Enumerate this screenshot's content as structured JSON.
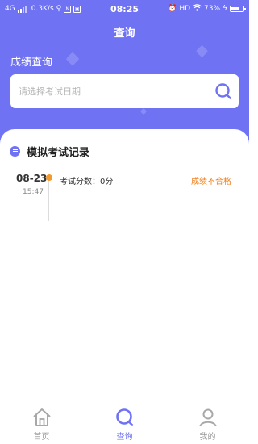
{
  "status_bar": {
    "network": "4G",
    "speed": "0.3K/s",
    "time": "08:25",
    "hd": "HD",
    "battery": "73%",
    "battery_level": 0.73
  },
  "header": {
    "title": "查询"
  },
  "search": {
    "label": "成绩查询",
    "placeholder": "请选择考试日期"
  },
  "records": {
    "title": "模拟考试记录",
    "items": [
      {
        "date": "08-23",
        "time": "15:47",
        "score": "考试分数：0分",
        "status": "成绩不合格"
      }
    ]
  },
  "tabbar": {
    "items": [
      {
        "label": "首页",
        "icon": "home-icon",
        "active": false
      },
      {
        "label": "查询",
        "icon": "search-icon",
        "active": true
      },
      {
        "label": "我的",
        "icon": "user-icon",
        "active": false
      }
    ]
  },
  "colors": {
    "primary": "#6e72f3",
    "warning": "#f07f1a",
    "dot": "#f39a2e"
  }
}
